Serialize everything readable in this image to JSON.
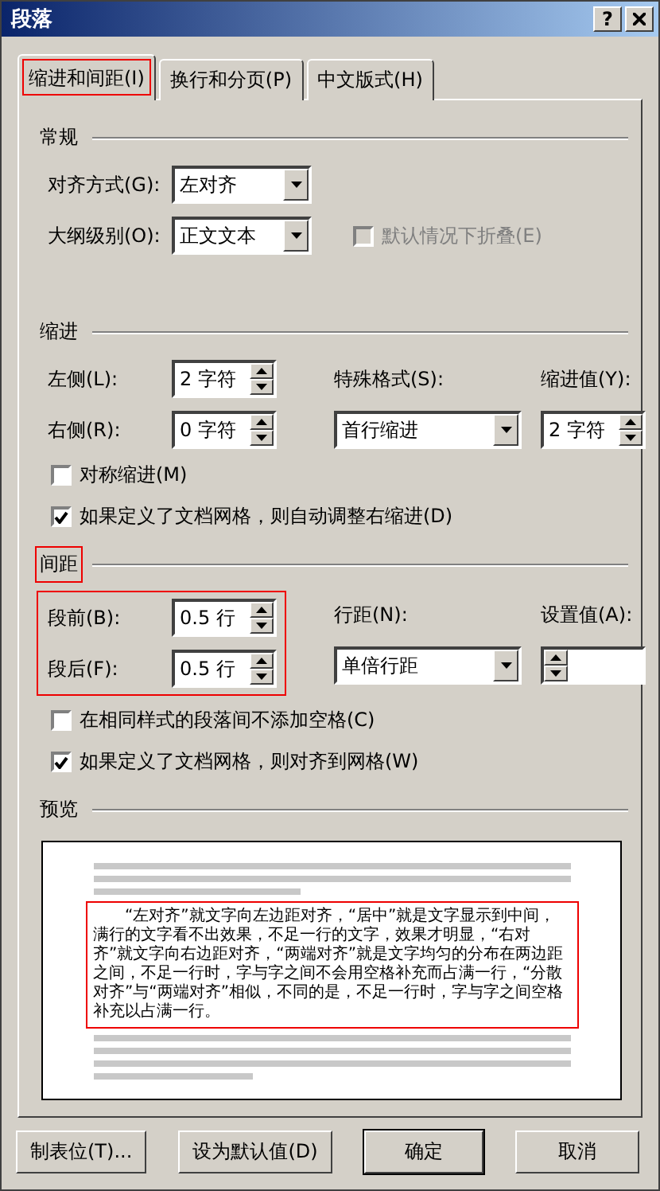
{
  "window": {
    "title": "段落",
    "help": "?"
  },
  "tabs": [
    {
      "label": "缩进和间距(I)",
      "selected": true,
      "highlighted": true
    },
    {
      "label": "换行和分页(P)",
      "selected": false,
      "highlighted": false
    },
    {
      "label": "中文版式(H)",
      "selected": false,
      "highlighted": false
    }
  ],
  "general": {
    "title": "常规",
    "alignment": {
      "label": "对齐方式(G):",
      "value": "左对齐"
    },
    "outline": {
      "label": "大纲级别(O):",
      "value": "正文文本"
    },
    "collapse": {
      "label": "默认情况下折叠(E)",
      "checked": false,
      "disabled": true
    }
  },
  "indent": {
    "title": "缩进",
    "left": {
      "label": "左侧(L):",
      "value": "2 字符"
    },
    "right": {
      "label": "右侧(R):",
      "value": "0 字符"
    },
    "special": {
      "label": "特殊格式(S):",
      "value": "首行缩进"
    },
    "by": {
      "label": "缩进值(Y):",
      "value": "2 字符"
    },
    "mirror": {
      "label": "对称缩进(M)",
      "checked": false,
      "disabled": false
    },
    "auto_adjust": {
      "label": "如果定义了文档网格，则自动调整右缩进(D)",
      "checked": true,
      "disabled": false
    }
  },
  "spacing": {
    "title": "间距",
    "highlighted": true,
    "before": {
      "label": "段前(B):",
      "value": "0.5 行"
    },
    "after": {
      "label": "段后(F):",
      "value": "0.5 行"
    },
    "line_spacing": {
      "label": "行距(N):",
      "value": "单倍行距"
    },
    "at": {
      "label": "设置值(A):"
    },
    "no_space": {
      "label": "在相同样式的段落间不添加空格(C)",
      "checked": false,
      "disabled": false
    },
    "snap": {
      "label": "如果定义了文档网格，则对齐到网格(W)",
      "checked": true,
      "disabled": false
    }
  },
  "preview": {
    "title": "预览",
    "text": "“左对齐”就文字向左边距对齐，“居中”就是文字显示到中间，满行的文字看不出效果，不足一行的文字，效果才明显，“右对齐”就文字向右边距对齐，“两端对齐”就是文字均匀的分布在两边距之间，不足一行时，字与字之间不会用空格补充而占满一行，“分散对齐”与“两端对齐”相似，不同的是，不足一行时，字与字之间空格补充以占满一行。",
    "highlighted": true
  },
  "buttons": [
    {
      "label": "制表位(T)...",
      "kind": "normal"
    },
    {
      "label": "设为默认值(D)",
      "kind": "normal"
    },
    {
      "label": "确定",
      "kind": "default"
    },
    {
      "label": "取消",
      "kind": "normal"
    }
  ]
}
